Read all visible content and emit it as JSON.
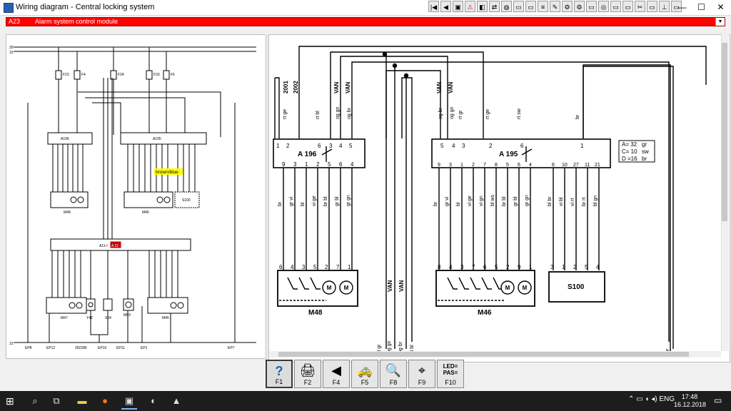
{
  "window": {
    "title": "Wiring diagram - Central locking system"
  },
  "toolbar": {
    "icons": [
      "first-page-icon",
      "prev-page-icon",
      "image-icon",
      "warning-icon",
      "color-icon",
      "nav-icon",
      "globe-icon",
      "car-icon",
      "car-icon",
      "list-icon",
      "tools-icon",
      "engine-icon",
      "engine-icon",
      "car-icon",
      "wheel-icon",
      "car-icon",
      "car-icon",
      "tools-icon",
      "car-icon",
      "lift-icon",
      "car-icon"
    ]
  },
  "window_controls": {
    "minimize": "—",
    "maximize": "☐",
    "close": "✕"
  },
  "selector": {
    "code": "A23",
    "name": "Alarm system control module",
    "arrow": "▼"
  },
  "left_diagram": {
    "rails": [
      "30",
      "15"
    ],
    "fuses": [
      "F23",
      "F4",
      "F34",
      "F33",
      "F6"
    ],
    "modules": [
      "A196",
      "A195",
      "A11-I"
    ],
    "badge": "A 22",
    "highlight": "brown/blue",
    "components": [
      "M48",
      "M46",
      "S100",
      "M47",
      "Y42",
      "S64",
      "M69",
      "M45"
    ],
    "bottom_rail": "31",
    "bottom_labels": [
      "EP8",
      "EP12",
      "302286",
      "EP10",
      "EP11",
      "EP1",
      "EP7"
    ]
  },
  "right_diagram": {
    "top_labels": [
      "2001",
      "2002",
      "VAN",
      "VAN",
      "VAN",
      "VAN"
    ],
    "wires_top_a196": [
      "rt ge",
      "rt bl",
      "og gn",
      "og br"
    ],
    "wires_top_a195": [
      "og br",
      "og gn",
      "rt gr",
      "rt ge",
      "rt sw",
      "br"
    ],
    "pins_a196_top": [
      "1",
      "2",
      "6",
      "3",
      "4",
      "5"
    ],
    "pins_a196_bottom": [
      "9",
      "3",
      "1",
      "2",
      "5",
      "6",
      "4"
    ],
    "pins_a195_top": [
      "5",
      "4",
      "3",
      "2",
      "6",
      "1"
    ],
    "pins_a195_bottom": [
      "9",
      "3",
      "1",
      "2",
      "7",
      "8",
      "5",
      "6",
      "4",
      "6",
      "10",
      "27",
      "11",
      "21"
    ],
    "wires_bottom_a196": [
      "br",
      "gr vi",
      "bl",
      "vi ge",
      "br bl",
      "gr bl",
      "gr gn"
    ],
    "wires_bottom_a195": [
      "br",
      "gr vi",
      "bl",
      "vi ge",
      "vi gn",
      "bl ws",
      "br bl",
      "gr bl",
      "gr gn",
      "bl br",
      "vi bl",
      "vi rt",
      "br rt",
      "bl gn"
    ],
    "modules": [
      "A 196",
      "A 195"
    ],
    "legend": [
      "A= 32",
      "gr",
      "C= 10",
      "sw",
      "D =16",
      "br"
    ],
    "components": [
      "M48",
      "M46",
      "S100"
    ],
    "pins_m48": [
      "6",
      "4",
      "3",
      "5",
      "2",
      "7",
      "1"
    ],
    "pins_m46": [
      "8",
      "4",
      "3",
      "7",
      "6",
      "5",
      "2",
      "9",
      "1"
    ],
    "pins_s100": [
      "3",
      "1",
      "2",
      "5",
      "4"
    ],
    "van_mid": [
      "VAN",
      "VAN"
    ],
    "bottom_wires": [
      "rt gr",
      "og gn",
      "og br",
      "rt bl",
      "br"
    ]
  },
  "fkeys": [
    {
      "label": "F1",
      "icon": "help-icon",
      "glyph": "?"
    },
    {
      "label": "F2",
      "icon": "print-icon",
      "glyph": "🖨"
    },
    {
      "label": "F4",
      "icon": "back-icon",
      "glyph": "◀"
    },
    {
      "label": "F5",
      "icon": "car-icon",
      "glyph": "🚕"
    },
    {
      "label": "F8",
      "icon": "search-icon",
      "glyph": "🔍"
    },
    {
      "label": "F9",
      "icon": "zoom-icon",
      "glyph": "⌖"
    },
    {
      "label": "F10",
      "icon": "led-icon",
      "glyph": "LED=\nPAS="
    }
  ],
  "taskbar": {
    "start": "⊞",
    "search": "⌕",
    "time": "17:48",
    "date": "16.12.2018"
  },
  "colors": {
    "selector": "#ff0000",
    "highlight": "#ffff00"
  }
}
